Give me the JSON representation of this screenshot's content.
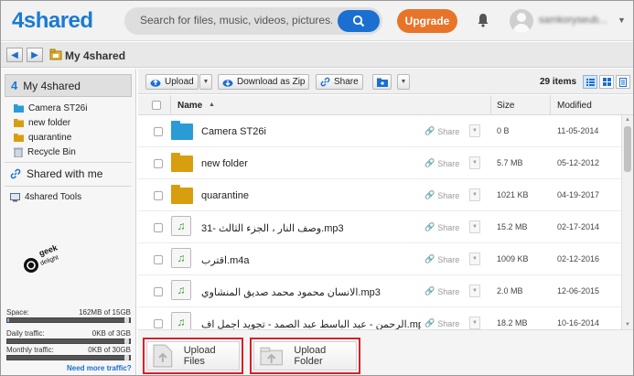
{
  "header": {
    "logo_text": "4shared",
    "search": {
      "placeholder": "Search for files, music, videos, pictures."
    },
    "upgrade_label": "Upgrade",
    "username": "samkoryseub..."
  },
  "navbar": {
    "breadcrumb": "My 4shared"
  },
  "sidebar": {
    "head_label": "My 4shared",
    "items": [
      {
        "label": "Camera ST26i",
        "icon": "folder-blue-icon"
      },
      {
        "label": "new folder",
        "icon": "folder-icon"
      },
      {
        "label": "quarantine",
        "icon": "folder-icon"
      },
      {
        "label": "Recycle Bin",
        "icon": "recycle-bin-icon"
      }
    ],
    "shared_label": "Shared with me",
    "tools_label": "4shared Tools",
    "watermark": "GeekDelight",
    "stats": {
      "space": {
        "label": "Space:",
        "value": "162MB of 15GB",
        "fraction": 0.01
      },
      "daily": {
        "label": "Daily traffic:",
        "value": "0KB of 3GB",
        "fraction": 0.0
      },
      "monthly": {
        "label": "Monthly traffic:",
        "value": "0KB of 30GB",
        "fraction": 0.0
      }
    },
    "more_traffic": "Need more traffic?"
  },
  "toolbar": {
    "upload_label": "Upload",
    "download_zip_label": "Download as Zip",
    "share_label": "Share",
    "items_count": "29 items"
  },
  "table": {
    "headers": {
      "name": "Name",
      "size": "Size",
      "modified": "Modified"
    },
    "share_label": "Share",
    "rows": [
      {
        "name": "Camera ST26i",
        "size": "0 B",
        "modified": "11-05-2014",
        "type": "folder-blue"
      },
      {
        "name": "new folder",
        "size": "5.7 MB",
        "modified": "05-12-2012",
        "type": "folder"
      },
      {
        "name": "quarantine",
        "size": "1021 KB",
        "modified": "04-19-2017",
        "type": "folder"
      },
      {
        "name": "31- وصف النار ، الجزء الثالث.mp3",
        "size": "15.2 MB",
        "modified": "02-17-2014",
        "type": "music"
      },
      {
        "name": "اقترب.m4a",
        "size": "1009 KB",
        "modified": "02-12-2016",
        "type": "music"
      },
      {
        "name": "الانسان محمود محمد صديق المنشاوي.mp3",
        "size": "2.0 MB",
        "modified": "12-06-2015",
        "type": "music"
      },
      {
        "name": "الرحمن - عبد الباسط عبد الصمد - تجويد اجمل اف.mp3",
        "size": "18.2 MB",
        "modified": "10-16-2014",
        "type": "music"
      }
    ]
  },
  "upload_bar": {
    "upload_files": "Upload Files",
    "upload_folder": "Upload Folder"
  },
  "colors": {
    "brand_blue": "#1a7ad4",
    "upgrade_orange": "#e8742a",
    "folder_gold": "#d89e10",
    "folder_blue": "#2b9bd6",
    "highlight_red": "#d81f26"
  }
}
